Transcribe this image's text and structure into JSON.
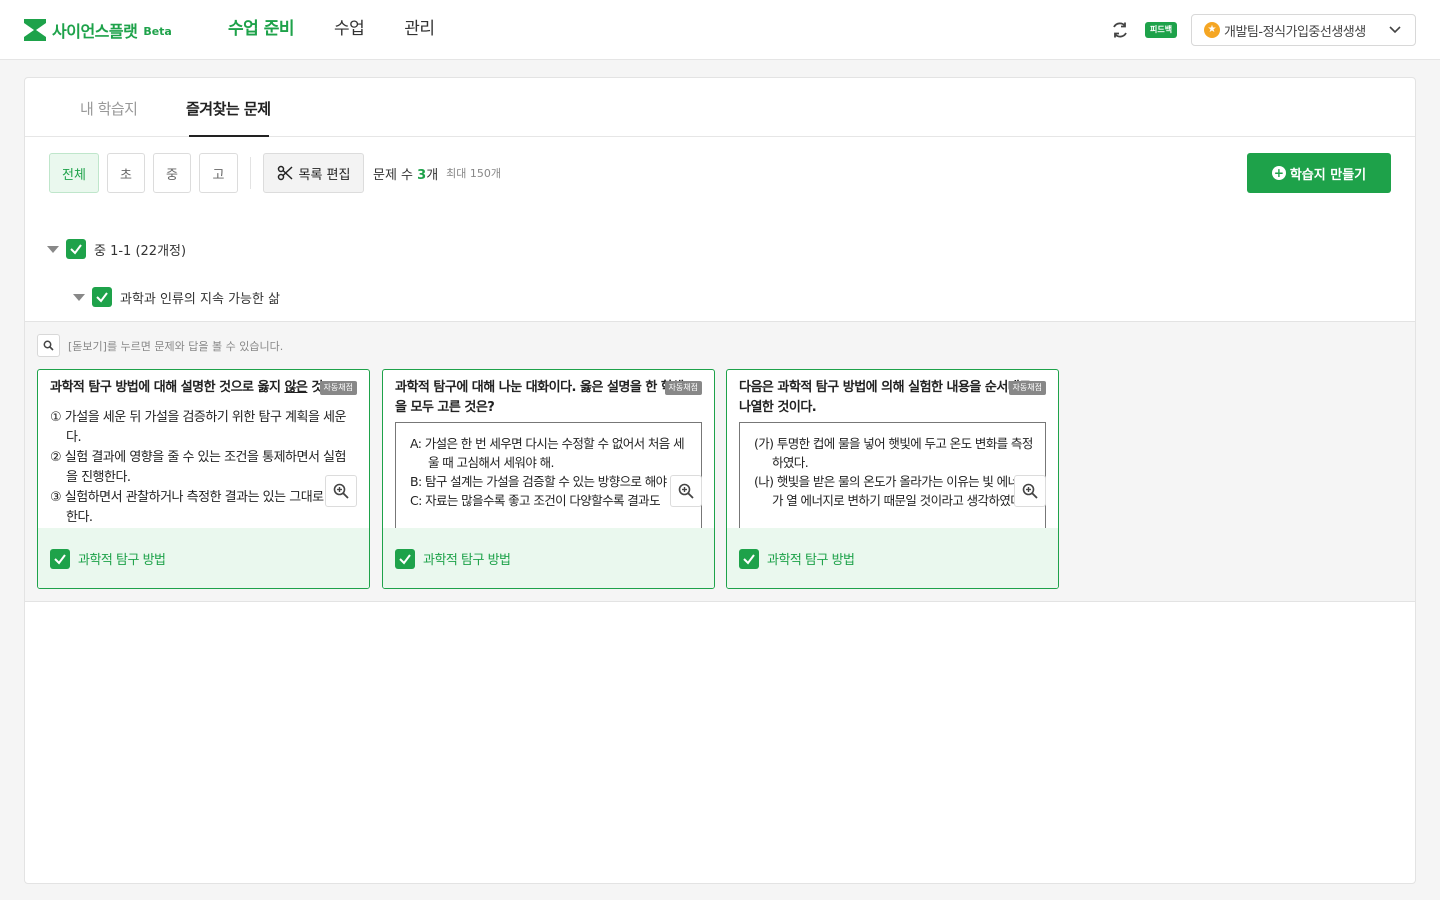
{
  "header": {
    "brand": "사이언스플랫",
    "beta": "Beta",
    "nav": [
      "수업 준비",
      "수업",
      "관리"
    ],
    "feedback": "피드백",
    "account_badge": "★",
    "account_name": "개발팀-정식가입중선생생생"
  },
  "tabs": [
    "내 학습지",
    "즐겨찾는 문제"
  ],
  "filters": {
    "all": "전체",
    "elementary": "초",
    "middle": "중",
    "high": "고",
    "edit": "목록 편집",
    "count_prefix": "문제 수 ",
    "count_value": "3",
    "count_suffix": "개",
    "max": "최대 150개"
  },
  "make_button": "학습지 만들기",
  "tree": {
    "level1": "중 1-1 (22개정)",
    "level2": "과학과 인류의 지속 가능한 삶"
  },
  "hint": "[돋보기]를 누르면 문제와 답을 볼 수 있습니다.",
  "cards": [
    {
      "title_a": "과학적 탐구 방법에 대해 설명한 것으로 옳지 ",
      "title_u": "않은",
      "title_b": " 것",
      "badge": "자동채점",
      "choices": [
        "① 가설을 세운 뒤 가설을 검증하기 위한 탐구 계획을 세운다.",
        "② 실험 결과에 영향을 줄 수 있는 조건을 통제하면서 실험을 진행한다.",
        "③ 실험하면서 관찰하거나 측정한 결과는 있는 그대로 기록한다."
      ],
      "tag": "과학적 탐구 방법"
    },
    {
      "title": "과학적 탐구에 대해 나눈 대화이다. 옳은 설명을 한 학생을 모두 고른 것은?",
      "badge": "자동채점",
      "choices": [
        "A: 가설은 한 번 세우면 다시는 수정할 수 없어서 처음 세울 때 고심해서 세워야 해.",
        "B: 탐구 설계는 가설을 검증할 수 있는 방향으로 해야 해.",
        "C: 자료는 많을수록 좋고 조건이 다양할수록 결과도"
      ],
      "tag": "과학적 탐구 방법"
    },
    {
      "title": "다음은 과학적 탐구 방법에 의해 실험한 내용을 순서대로 나열한 것이다.",
      "badge": "자동채점",
      "choices": [
        "(가) 투명한 컵에 물을 넣어 햇빛에 두고 온도 변화를 측정하였다.",
        "(나) 햇빛을 받은 물의 온도가 올라가는 이유는 빛 에너지가 열 에너지로 변하기 때문일 것이라고 생각하였다."
      ],
      "tag": "과학적 탐구 방법"
    }
  ],
  "colors": {
    "brand": "#1ea24a",
    "brand_light": "#eaf8ee"
  }
}
